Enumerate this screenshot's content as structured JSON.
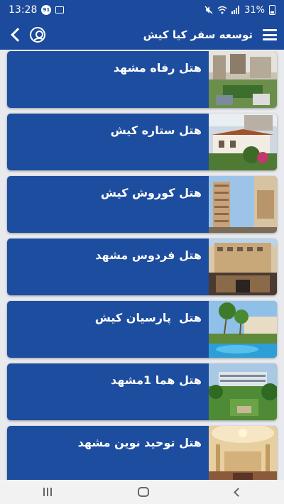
{
  "status_bar": {
    "time": "13:28",
    "notification_badge": "91",
    "battery_percent": "31%"
  },
  "app_bar": {
    "title": "توسعه سفر کیا کیش"
  },
  "hotels": [
    {
      "name": "هتل رفاه مشهد"
    },
    {
      "name": "هتل ستاره کیش"
    },
    {
      "name": "هتل کوروش کیش"
    },
    {
      "name": "هتل فردوس مشهد"
    },
    {
      "name": "هتل  پارسیان کیش"
    },
    {
      "name": "هتل هما 1مشهد"
    },
    {
      "name": "هتل توحید نوین مشهد"
    }
  ],
  "colors": {
    "primary": "#1c4a9c",
    "card": "#1d4d9f",
    "background": "#e8eaee"
  }
}
